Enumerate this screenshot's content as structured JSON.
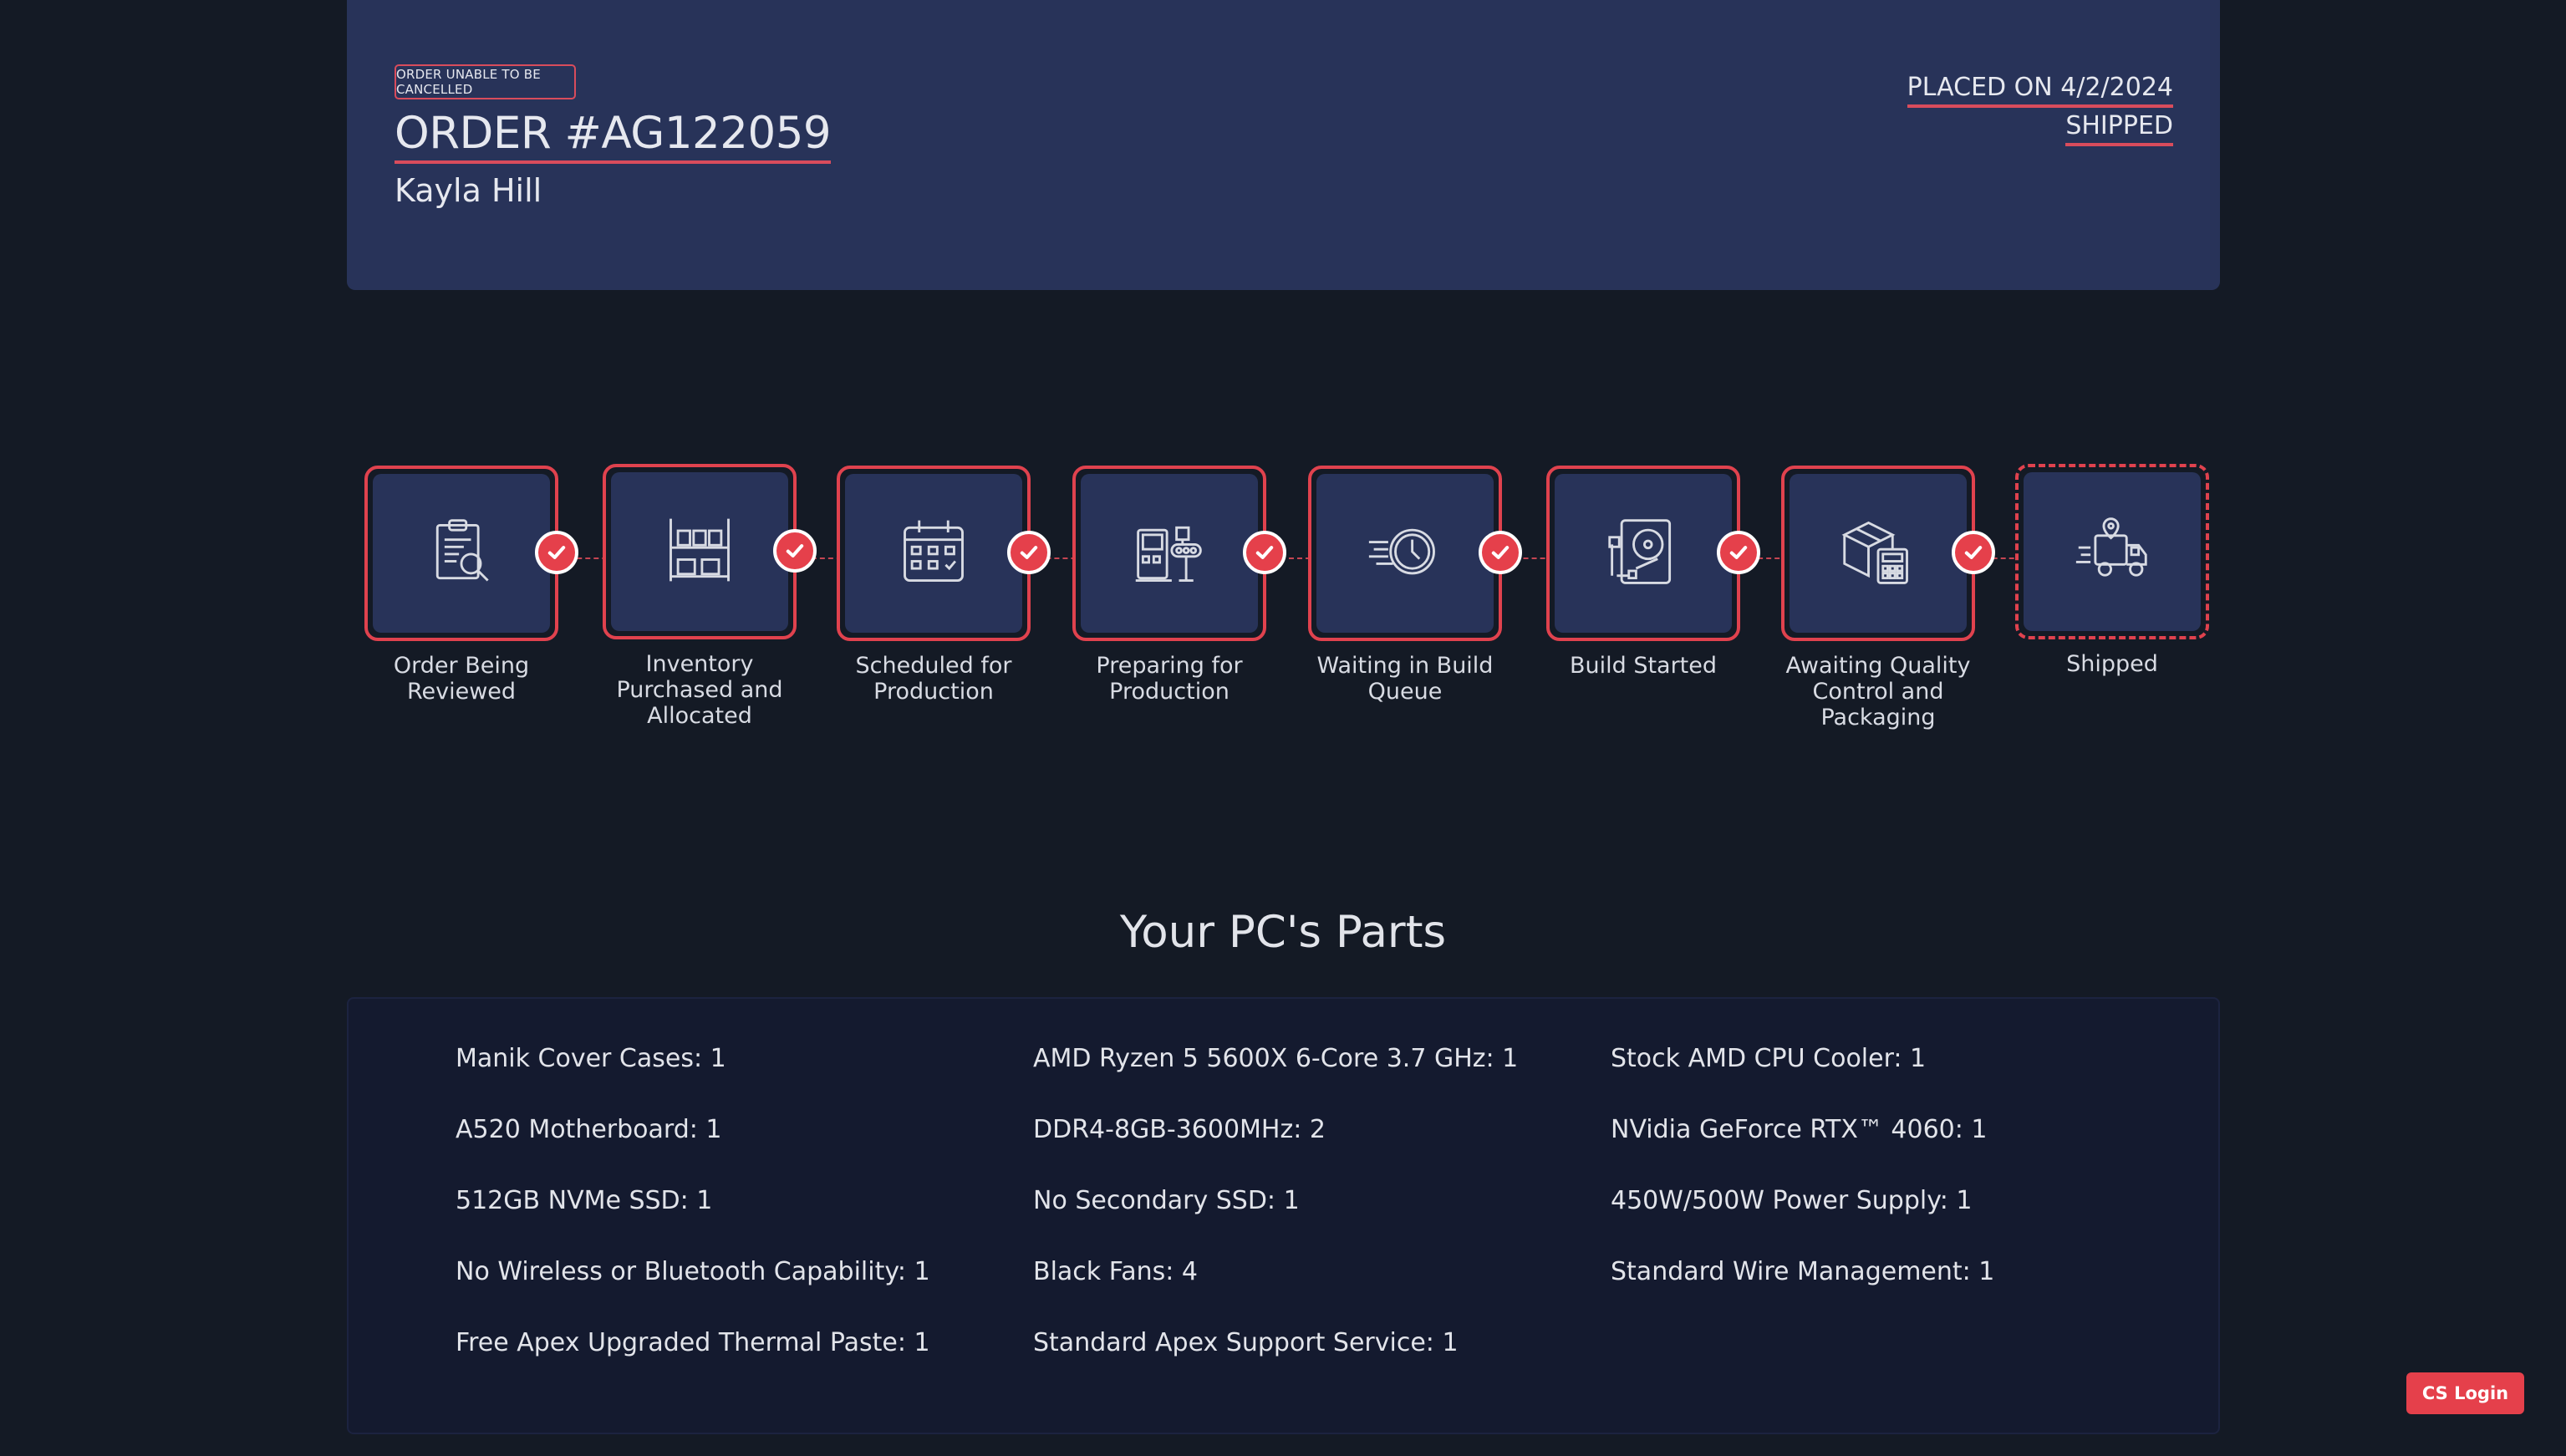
{
  "header": {
    "cancel_badge": "ORDER UNABLE TO BE CANCELLED",
    "order_title": "ORDER #AG122059",
    "customer_name": "Kayla Hill",
    "placed_on": "PLACED ON 4/2/2024",
    "status": "SHIPPED"
  },
  "steps": [
    {
      "label": "Order Being Reviewed",
      "icon": "clipboard-search-icon",
      "completed": true
    },
    {
      "label": "Inventory Purchased and Allocated",
      "icon": "shelves-icon",
      "completed": true
    },
    {
      "label": "Scheduled for Production",
      "icon": "calendar-icon",
      "completed": true
    },
    {
      "label": "Preparing for Production",
      "icon": "machine-icon",
      "completed": true
    },
    {
      "label": "Waiting in Build Queue",
      "icon": "clock-fast-icon",
      "completed": true
    },
    {
      "label": "Build Started",
      "icon": "hard-drive-icon",
      "completed": true
    },
    {
      "label": "Awaiting Quality Control and Packaging",
      "icon": "box-calculator-icon",
      "completed": true
    },
    {
      "label": "Shipped",
      "icon": "delivery-truck-icon",
      "completed": false
    }
  ],
  "parts": {
    "heading": "Your PC's Parts",
    "columns": [
      [
        "Manik Cover Cases: 1",
        "A520 Motherboard: 1",
        "512GB NVMe SSD: 1",
        "No Wireless or Bluetooth Capability: 1",
        "Free Apex Upgraded Thermal Paste: 1"
      ],
      [
        "AMD Ryzen 5 5600X 6-Core 3.7 GHz: 1",
        "DDR4-8GB-3600MHz: 2",
        "No Secondary SSD: 1",
        "Black Fans: 4",
        "Standard Apex Support Service: 1"
      ],
      [
        "Stock AMD CPU Cooler: 1",
        "NVidia GeForce RTX™ 4060: 1",
        "450W/500W Power Supply: 1",
        "Standard Wire Management: 1"
      ]
    ]
  },
  "cs_login_label": "CS Login",
  "colors": {
    "page_bg": "#141a25",
    "card_bg": "#283359",
    "accent": "#e5404b",
    "parts_bg": "#141a2f"
  }
}
